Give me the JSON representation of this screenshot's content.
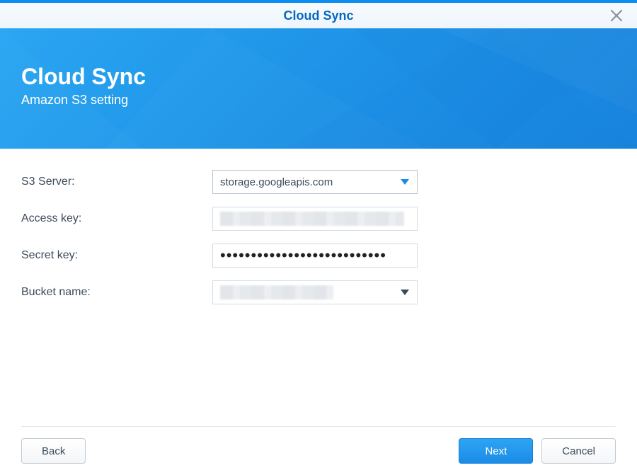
{
  "window": {
    "title": "Cloud Sync"
  },
  "hero": {
    "title": "Cloud Sync",
    "subtitle": "Amazon S3 setting"
  },
  "form": {
    "s3_server": {
      "label": "S3 Server:",
      "value": "storage.googleapis.com"
    },
    "access_key": {
      "label": "Access key:",
      "value": ""
    },
    "secret_key": {
      "label": "Secret key:",
      "masked": "•••••••••••••••••••••••••••"
    },
    "bucket_name": {
      "label": "Bucket name:",
      "value": ""
    }
  },
  "footer": {
    "back": "Back",
    "next": "Next",
    "cancel": "Cancel"
  },
  "colors": {
    "accent": "#1b8ce6",
    "hero_bg": "#2ba6f2"
  }
}
